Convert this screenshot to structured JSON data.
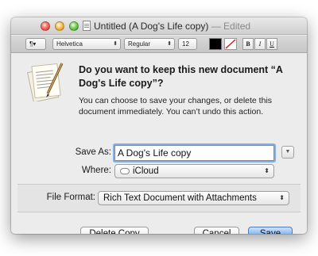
{
  "window": {
    "title": "Untitled (A Dog's Life copy)",
    "title_suffix": "— Edited"
  },
  "toolbar": {
    "paragraph_style": "¶▾",
    "font_family": "Helvetica",
    "font_style": "Regular",
    "font_size": "12",
    "text_color": "#000000",
    "bold_label": "B",
    "italic_label": "I",
    "underline_label": "U"
  },
  "dialog": {
    "heading": "Do you want to keep this new document “A Dog's Life copy”?",
    "message": "You can choose to save your changes, or delete this document immediately. You can’t undo this action.",
    "save_as_label": "Save As:",
    "save_as_value": "A Dog's Life copy",
    "where_label": "Where:",
    "where_value": "iCloud",
    "file_format_label": "File Format:",
    "file_format_value": "Rich Text Document with Attachments",
    "delete_label": "Delete Copy",
    "cancel_label": "Cancel",
    "save_label": "Save"
  },
  "icons": {
    "app": "textedit-icon",
    "location": "cloud-icon",
    "expand": "disclosure-triangle-icon"
  },
  "colors": {
    "default_button": "#6aa4ec",
    "focus_ring": "#7eb0ea"
  }
}
